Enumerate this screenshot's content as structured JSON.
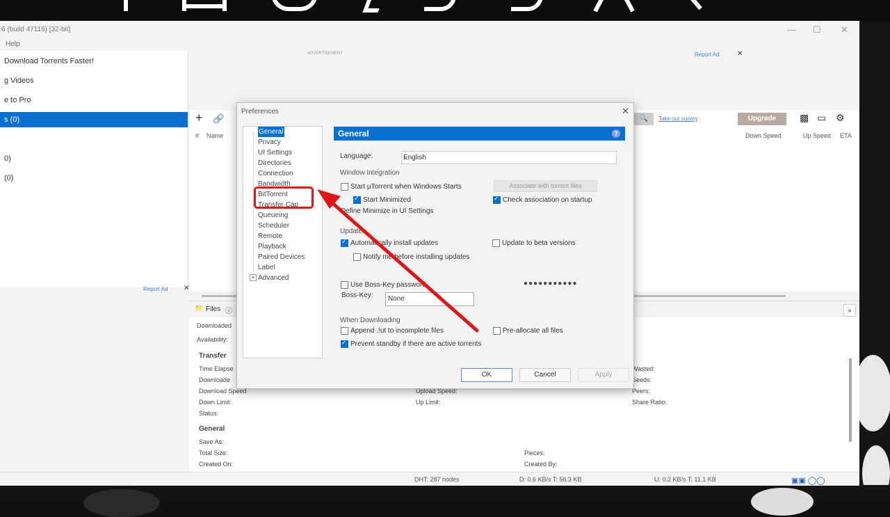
{
  "window": {
    "title": "6  (build 47116) [32-bit]",
    "menu_help": "Help",
    "min": "—",
    "max": "☐",
    "close": "✕"
  },
  "sidebar": {
    "items": [
      {
        "label": "Download Torrents Faster!"
      },
      {
        "label": "g Videos"
      },
      {
        "label": "e to Pro"
      },
      {
        "label": "s (0)"
      },
      {
        "label": "0)"
      },
      {
        "label": "(0)"
      }
    ],
    "report_ad": "Report Ad",
    "close": "✕"
  },
  "ad_top": {
    "label": "ADVERTISEMENT",
    "report_ad": "Report Ad",
    "close": "✕"
  },
  "toolbar": {
    "add_icon": "+",
    "link_icon": "🔗",
    "search_icon": "🔍",
    "survey_link": "Take our survey",
    "upgrade_label": "Upgrade"
  },
  "columns": {
    "num": "#",
    "name": "Name",
    "down_speed": "Down Speed",
    "up_speed": "Up Speed",
    "eta": "ETA"
  },
  "details": {
    "files_label": "Files",
    "downloaded": "Downloaded",
    "availability": "Availability:",
    "transfer_heading": "Transfer",
    "time_elapsed": "Time Elapse",
    "downloaded2": "Downloade",
    "download_speed": "Download Speed",
    "down_limit": "Down Limit:",
    "status": "Status:",
    "upload_speed": "Upload Speed:",
    "up_limit": "Up Limit:",
    "wasted": "Wasted:",
    "seeds": "Seeds:",
    "peers": "Peers:",
    "share_ratio": "Share Ratio:",
    "general_heading": "General",
    "save_as": "Save As:",
    "total_size": "Total Size:",
    "created_on": "Created On:",
    "pieces": "Pieces:",
    "created_by": "Created By:"
  },
  "statusbar": {
    "dht": "DHT: 287 nodes",
    "down": "D: 0.6 KB/s T: 56.3 KB",
    "up": "U: 0.2 KB/s T: 11.1 KB"
  },
  "dialog": {
    "title": "Preferences",
    "close": "✕",
    "tree": [
      "General",
      "Privacy",
      "UI Settings",
      "Directories",
      "Connection",
      "Bandwidth",
      "BitTorrent",
      "Transfer Cap",
      "Queueing",
      "Scheduler",
      "Remote",
      "Playback",
      "Paired Devices",
      "Label",
      "Advanced"
    ],
    "section_title": "General",
    "language_label": "Language:",
    "language_value": "English",
    "window_integration": "Window Integration",
    "start_with_windows": "Start µTorrent when Windows Starts",
    "start_minimized": "Start Minimized",
    "define_minimize": "Define Minimize in UI Settings",
    "associate_btn": "Associate with torrent files",
    "check_association": "Check association on startup",
    "updates": "Updates",
    "auto_install": "Automatically install updates",
    "beta_updates": "Update to beta versions",
    "notify_before": "Notify me before installing updates",
    "boss_key_pw": "Use Boss-Key password",
    "boss_key_label": "Boss-Key:",
    "boss_key_value": "None",
    "password_dots": "●●●●●●●●●●●",
    "when_downloading": "When Downloading",
    "append_ut": "Append .!ut to incomplete files",
    "preallocate": "Pre-allocate all files",
    "prevent_standby": "Prevent standby if there are active torrents",
    "ok": "OK",
    "cancel": "Cancel",
    "apply": "Apply",
    "help_icon": "?"
  },
  "annotation": {
    "highlight_color": "#e01616"
  }
}
